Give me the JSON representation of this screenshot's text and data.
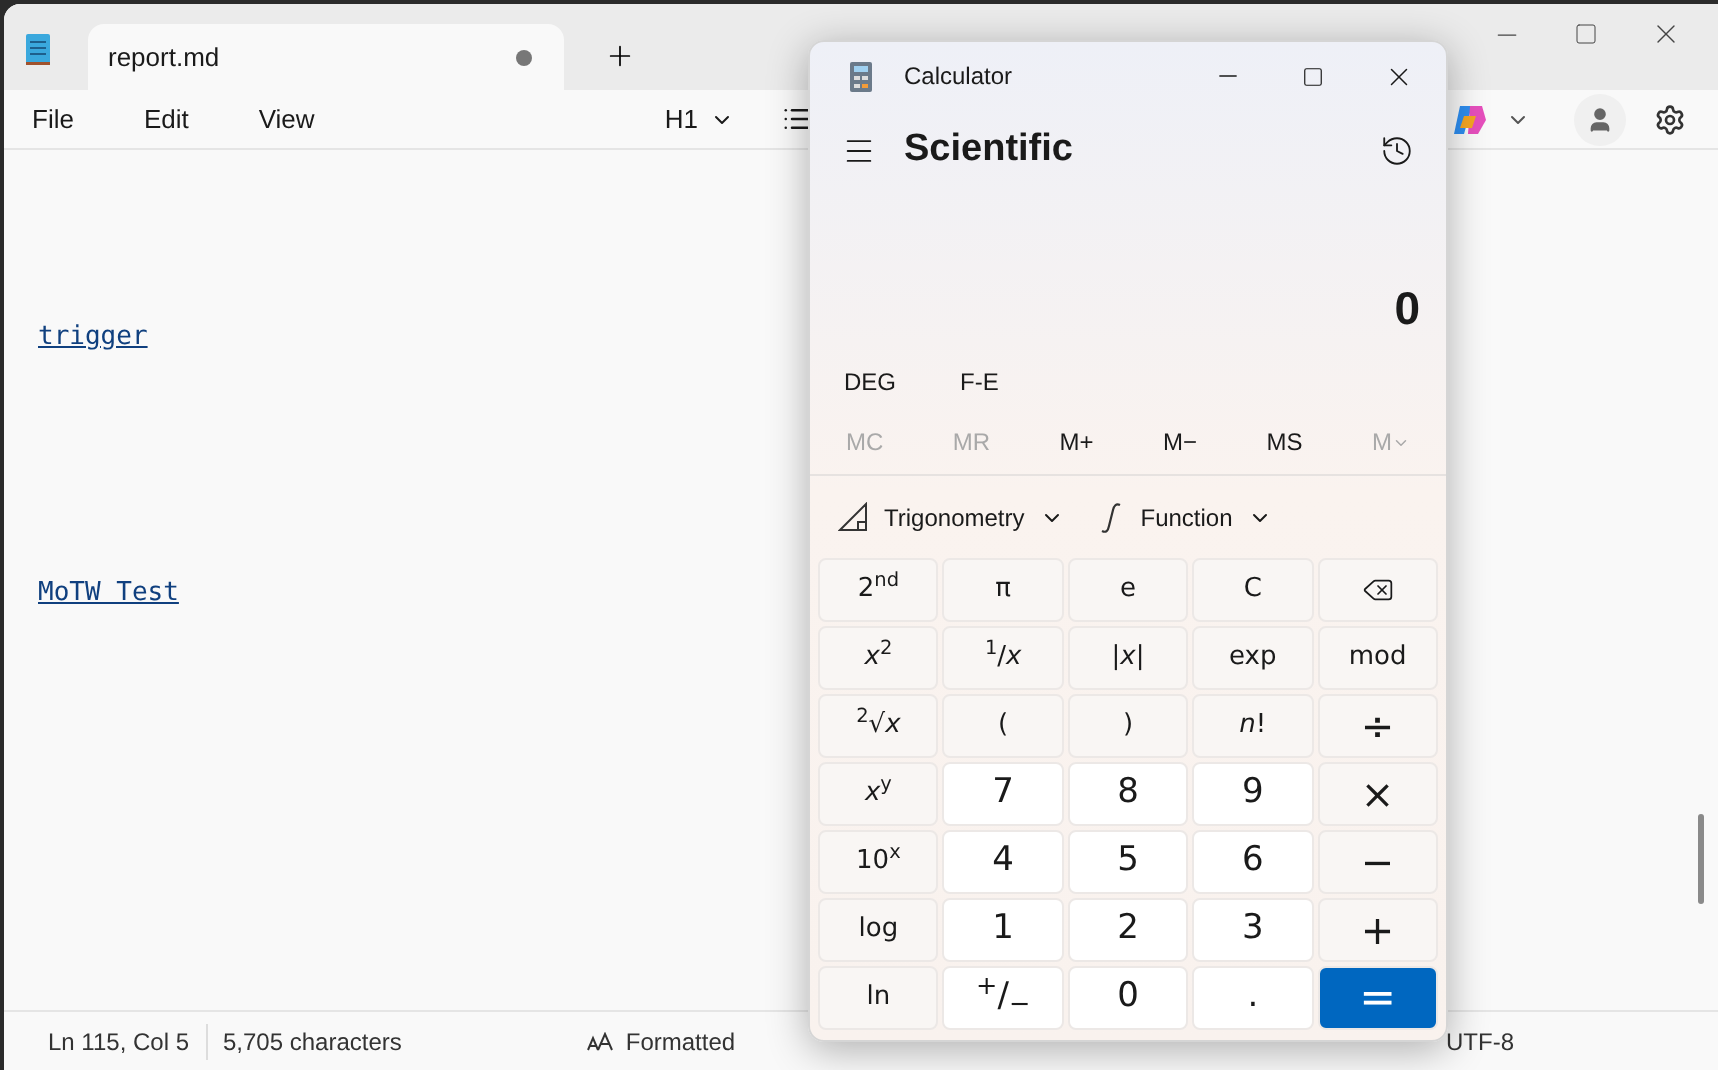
{
  "notepad": {
    "tab": {
      "title": "report.md",
      "unsaved": true
    },
    "menu": [
      "File",
      "Edit",
      "View"
    ],
    "toolbar": {
      "heading": "H1"
    },
    "lines": [
      {
        "text": "trigger",
        "kind": "link"
      },
      {
        "text": "MoTW Test",
        "kind": "link"
      }
    ],
    "status_bar": {
      "position": "Ln 115, Col 5",
      "characters": "5,705 characters",
      "format": "Formatted",
      "encoding": "UTF-8"
    }
  },
  "calculator": {
    "title": "Calculator",
    "mode": "Scientific",
    "display": "0",
    "angle_buttons": [
      "DEG",
      "F-E"
    ],
    "memory": [
      {
        "label": "MC",
        "disabled": true
      },
      {
        "label": "MR",
        "disabled": true
      },
      {
        "label": "M+",
        "disabled": false
      },
      {
        "label": "M−",
        "disabled": false
      },
      {
        "label": "MS",
        "disabled": false
      },
      {
        "label": "M",
        "disabled": true,
        "kind": "dropdown"
      }
    ],
    "menus": [
      {
        "label": "Trigonometry",
        "kind": "trig"
      },
      {
        "label": "Function",
        "kind": "function"
      }
    ],
    "keys": [
      {
        "label": "2$^{nd}$",
        "kind": "fn"
      },
      {
        "label": "π",
        "kind": "fn"
      },
      {
        "label": "e",
        "kind": "fn"
      },
      {
        "label": "C",
        "kind": "fn"
      },
      {
        "kind": "backspace"
      },
      {
        "label": "*x*$^{2}$",
        "kind": "fn"
      },
      {
        "label": "$^{1}$/*x*",
        "kind": "fn"
      },
      {
        "label": "|*x*|",
        "kind": "fn"
      },
      {
        "label": "exp",
        "kind": "fn"
      },
      {
        "label": "mod",
        "kind": "fn"
      },
      {
        "label": "$^{2}$√*x*",
        "kind": "fn"
      },
      {
        "label": "(",
        "kind": "fn"
      },
      {
        "label": ")",
        "kind": "fn"
      },
      {
        "label": "*n*!",
        "kind": "fn"
      },
      {
        "label": "÷",
        "kind": "op"
      },
      {
        "label": "*x*$^{y}$",
        "kind": "fn"
      },
      {
        "label": "7",
        "kind": "num"
      },
      {
        "label": "8",
        "kind": "num"
      },
      {
        "label": "9",
        "kind": "num"
      },
      {
        "label": "×",
        "kind": "op"
      },
      {
        "label": "10$^{x}$",
        "kind": "fn"
      },
      {
        "label": "4",
        "kind": "num"
      },
      {
        "label": "5",
        "kind": "num"
      },
      {
        "label": "6",
        "kind": "num"
      },
      {
        "label": "−",
        "kind": "op"
      },
      {
        "label": "log",
        "kind": "fn"
      },
      {
        "label": "1",
        "kind": "num"
      },
      {
        "label": "2",
        "kind": "num"
      },
      {
        "label": "3",
        "kind": "num"
      },
      {
        "label": "+",
        "kind": "op"
      },
      {
        "label": "ln",
        "kind": "fn"
      },
      {
        "label": "$^{+}$/$_{−}$",
        "kind": "num"
      },
      {
        "label": "0",
        "kind": "num"
      },
      {
        "label": ".",
        "kind": "num"
      },
      {
        "label": "=",
        "kind": "equals"
      }
    ]
  }
}
